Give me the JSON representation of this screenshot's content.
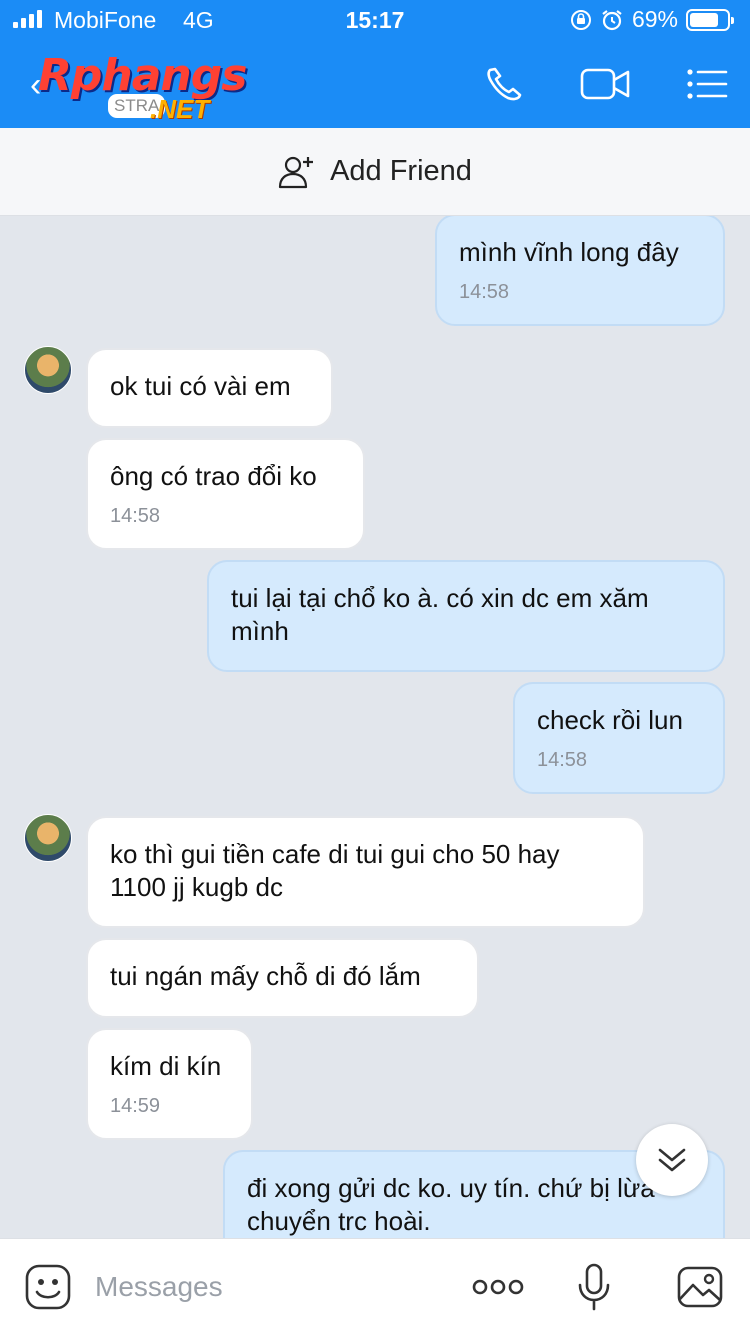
{
  "status_bar": {
    "carrier": "MobiFone",
    "network": "4G",
    "time": "15:17",
    "battery": "69%",
    "battery_level": 0.69,
    "icons": [
      "orientation-lock-icon",
      "alarm-icon"
    ]
  },
  "header": {
    "logo_main": "Rphangs",
    "logo_sub": "STRA",
    "logo_net": ".NET",
    "icons": [
      "back-icon",
      "phone-icon",
      "video-call-icon",
      "menu-icon"
    ]
  },
  "add_friend": {
    "label": "Add Friend",
    "icon": "add-friend-icon"
  },
  "messages": [
    {
      "side": "out",
      "text": "mình vĩnh long đây",
      "time": "14:58"
    },
    {
      "side": "in",
      "text": "ok tui có vài em",
      "time": ""
    },
    {
      "side": "in",
      "text": "ông có trao đổi ko",
      "time": "14:58"
    },
    {
      "side": "out",
      "text": "tui lại tại chổ ko à. có xin dc em xăm mình",
      "time": ""
    },
    {
      "side": "out",
      "text": "check rồi lun",
      "time": "14:58"
    },
    {
      "side": "in",
      "text": "ko thì gui tiền cafe di tui gui cho 50 hay 1100 jj kugb dc",
      "time": ""
    },
    {
      "side": "in",
      "text": "tui ngán mấy chỗ di đó lắm",
      "time": ""
    },
    {
      "side": "in",
      "text": "kím di kín",
      "time": "14:59"
    },
    {
      "side": "out",
      "text": "đi xong gửi dc ko. uy tín. chứ bị lừa chuyển trc hoài.",
      "time": ""
    }
  ],
  "input": {
    "placeholder": "Messages",
    "icons": [
      "sticker-icon",
      "more-icon",
      "microphone-icon",
      "image-icon"
    ]
  },
  "scroll_down": {
    "icon": "double-chevron-down-icon"
  }
}
